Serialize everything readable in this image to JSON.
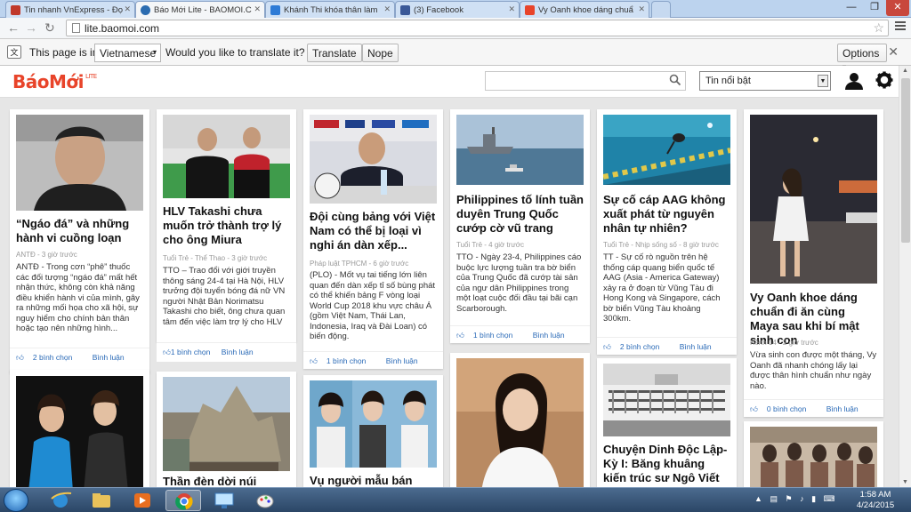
{
  "browser": {
    "tabs": [
      {
        "label": "Tin nhanh VnExpress - Đọ",
        "favicon_color": "#c0392b"
      },
      {
        "label": "Báo Mới Lite - BAOMOI.C",
        "favicon_color": "#2b6cb0"
      },
      {
        "label": "Khánh Thi khóa thân làm",
        "favicon_color": "#2e7bd6"
      },
      {
        "label": "(3) Facebook",
        "favicon_color": "#3b5998"
      },
      {
        "label": "Vy Oanh khoe dáng chuẩ",
        "favicon_color": "#e8442a"
      }
    ],
    "url": "lite.baomoi.com"
  },
  "translate_bar": {
    "prefix": "This page is in",
    "language": "Vietnamese",
    "question": "Would you like to translate it?",
    "translate_label": "Translate",
    "nope_label": "Nope",
    "options_label": "Options"
  },
  "site": {
    "logo": "BáoMới",
    "logo_sup": "LITE",
    "filter_selected": "Tin nổi bật",
    "accent": "#e8442a"
  },
  "cards": [
    {
      "title": "“Ngáo đá” và những hành vi cuồng loạn",
      "meta": "ANTĐ - 3 giờ trước",
      "summary": "ANTĐ - Trong cơn “phê” thuốc các đối tượng “ngáo đá” mất hết nhận thức, không còn khả năng điều khiển hành vi của mình, gây ra những mối họa cho xã hội, sự nguy hiểm cho chính bản thân hoặc tạo nên những hình...",
      "likes": "2 bình chọn",
      "comment": "Bình luận"
    },
    {
      "title": "HLV Takashi chưa muốn trở thành trợ lý cho ông Miura",
      "meta": "Tuổi Trẻ - Thể Thao - 3 giờ trước",
      "summary": "TTO – Trao đổi với giới truyền thông sáng 24-4 tại Hà Nội, HLV trưởng đội tuyển bóng đá nữ VN người Nhật Bản Norimatsu Takashi cho biết, ông chưa quan tâm đến việc làm trợ lý cho HLV Miura ở đội tuyển quốc gia...",
      "likes": "1 bình chọn",
      "comment": "Bình luận"
    },
    {
      "title": "Đội cùng bảng với Việt Nam có thể bị loại vì nghi án dàn xếp...",
      "meta": "Pháp luật TPHCM - 6 giờ trước",
      "summary": "(PLO) - Mốt vụ tai tiếng lớn liên quan đến dàn xếp tỉ số bùng phát có thể khiến bảng F vòng loại World Cup 2018 khu vực châu Á (gồm Việt Nam, Thái Lan, Indonesia, Iraq và Đài Loan) có biến động.",
      "likes": "1 bình chọn",
      "comment": "Bình luận"
    },
    {
      "title": "Philippines tố lính tuần duyên Trung Quốc cướp cờ vũ trang",
      "meta": "Tuổi Trẻ - 4 giờ trước",
      "summary": "TTO - Ngày 23-4, Philippines cáo buộc lực lượng tuần tra bờ biển của Trung Quốc đã cướp tài sản của ngư dân Philippines trong một loạt cuộc đối đầu tại bãi cạn Scarborough.",
      "likes": "1 bình chọn",
      "comment": "Bình luận"
    },
    {
      "title": "Sự cố cáp AAG không xuất phát từ nguyên nhân tự nhiên?",
      "meta": "Tuổi Trẻ - Nhịp sống số - 8 giờ trước",
      "summary": "TT - Sự cố rò nguồn trên hệ thống cáp quang biển quốc tế AAG (Asia - America Gateway) xảy ra ở đoạn từ Vũng Tàu đi Hong Kong và Singapore, cách bờ biển Vũng Tàu khoảng 300km.",
      "likes": "2 bình chọn",
      "comment": "Bình luận"
    },
    {
      "title": "Vy Oanh khoe dáng chuẩn đi ăn cùng Maya sau khi bí mật sinh con",
      "meta": "Kênh 14 - 2 giờ trước",
      "summary": "Vừa sinh con được một tháng, Vy Oanh đã nhanh chóng lấy lại được thân hình chuẩn như ngày nào.",
      "likes": "0 bình chọn",
      "comment": "Bình luận"
    },
    {
      "title": "Thần đèn dời núi Đức...",
      "meta": "",
      "summary": "",
      "likes": "",
      "comment": ""
    },
    {
      "title": "Vụ người mẫu bán dâm",
      "meta": "",
      "summary": "",
      "likes": "",
      "comment": ""
    },
    {
      "title": "Chuyện Dinh Độc Lập-Kỳ I: Băng khuâng kiến trúc sư Ngô Viết Thụ",
      "meta": "",
      "summary": "",
      "likes": "",
      "comment": ""
    }
  ],
  "taskbar": {
    "time": "1:58 AM",
    "date": "4/24/2015"
  }
}
